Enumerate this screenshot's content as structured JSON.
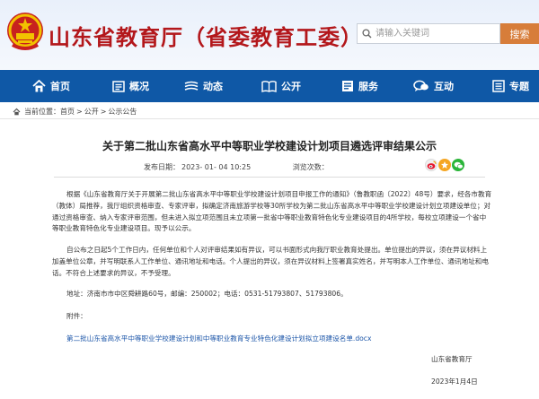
{
  "header": {
    "site_title": "山东省教育厅（省委教育工委）",
    "search_placeholder": "请输入关键词",
    "search_button": "搜索"
  },
  "nav": {
    "items": [
      {
        "label": "首页",
        "icon": "home-icon"
      },
      {
        "label": "概况",
        "icon": "overview-icon"
      },
      {
        "label": "动态",
        "icon": "news-icon"
      },
      {
        "label": "公开",
        "icon": "book-icon"
      },
      {
        "label": "服务",
        "icon": "service-icon"
      },
      {
        "label": "互动",
        "icon": "chat-icon"
      },
      {
        "label": "专题",
        "icon": "topic-icon"
      }
    ]
  },
  "breadcrumb": {
    "prefix": "当前位置：",
    "items": [
      "首页",
      "公开",
      "公示公告"
    ],
    "separator": ">"
  },
  "article": {
    "title": "关于第二批山东省高水平中等职业学校建设计划项目遴选评审结果公示",
    "publish_label": "发布日期：",
    "publish_date": "2023- 01- 04 10:25",
    "views_label": "浏览次数：",
    "views": "",
    "paragraph1": "根据《山东省教育厅关于开展第二批山东省高水平中等职业学校建设计划项目申报工作的通知》（鲁教职函〔2022〕48号）要求，经各市教育（教体）局推荐，我厅组织资格审查、专家评审，拟确定济南旅游学校等30所学校为第二批山东省高水平中等职业学校建设计划立项建设单位；对通过资格审查、纳入专家评审范围，但未进入拟立项范围且未立项第一批省中等职业教育特色化专业建设项目的4所学校，每校立项建设一个省中等职业教育特色化专业建设项目。现予以公示。",
    "paragraph2": "自公布之日起5个工作日内，任何单位和个人对评审结果如有异议，可以书面形式向我厅职业教育处提出。单位提出的异议，须在异议材料上加盖单位公章，并写明联系人工作单位、通讯地址和电话。个人提出的异议，须在异议材料上签署真实姓名，并写明本人工作单位、通讯地址和电话。不符合上述要求的异议，不予受理。",
    "address": "地址：济南市市中区舜耕路60号，邮编：250002；电话：0531-51793807、51793806。",
    "attachment_label": "附件：",
    "attachment_link": "第二批山东省高水平中等职业学校建设计划和中等职业教育专业特色化建设计划拟立项建设名单.docx",
    "signature": "山东省教育厅",
    "sign_date": "2023年1月4日"
  },
  "colors": {
    "title_red": "#b3171b",
    "nav_blue": "#0f58a6",
    "search_orange": "#d77d3a",
    "link_blue": "#1b55a8"
  }
}
